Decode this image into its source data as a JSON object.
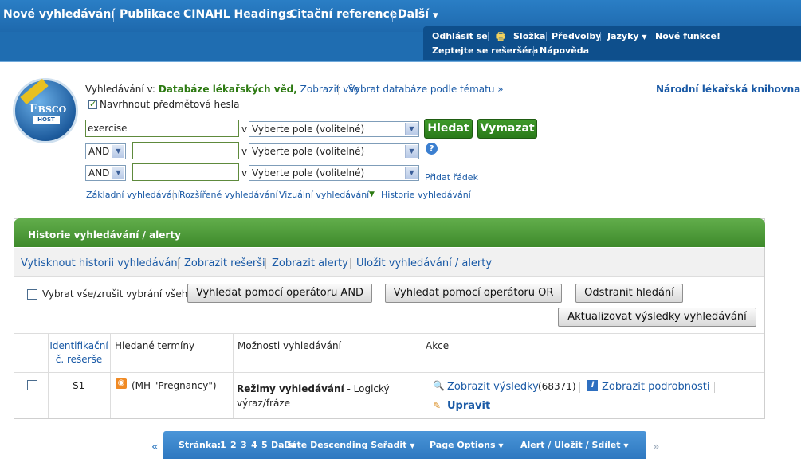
{
  "topnav": {
    "new_search": "Nové vyhledávání",
    "publications": "Publikace",
    "cinahl": "CINAHL Headings",
    "citations": "Citační reference",
    "more": "Další"
  },
  "userbar": {
    "logout": "Odhlásit se",
    "folder": "Složka",
    "preferences": "Předvolby",
    "languages": "Jazyky",
    "new_features": "Nové funkce!",
    "ask_librarian": "Zeptejte se rešeršéra",
    "help": "Nápověda"
  },
  "search": {
    "searching_in_label": "Vyhledávání v:",
    "database": "Databáze lékařských věd,",
    "show_all": "Zobrazit vše",
    "choose_by_topic": "Vybrat databáze podle tématu »",
    "library": "Národní lékařská knihovna",
    "suggest_terms": "Navrhnout předmětová hesla",
    "row1_value": "exercise",
    "in_label": "v",
    "field_placeholder": "Vyberte pole (volitelné)",
    "operator": "AND",
    "search_btn": "Hledat",
    "clear_btn": "Vymazat",
    "add_row": "Přidat řádek",
    "basic": "Základní vyhledávání",
    "advanced": "Rozšířené vyhledávání",
    "visual": "Vizuální vyhledávání",
    "history": "Historie vyhledávání"
  },
  "history": {
    "title": "Historie vyhledávání / alerty",
    "print": "Vytisknout historii vyhledávání",
    "show_searches": "Zobrazit rešerši",
    "show_alerts": "Zobrazit alerty",
    "save": "Uložit vyhledávání / alerty",
    "select_all": "Vybrat vše/zrušit vybrání všeho",
    "and_btn": "Vyhledat pomocí operátoru AND",
    "or_btn": "Vyhledat pomocí operátoru OR",
    "remove_btn": "Odstranit hledání",
    "refresh_btn": "Aktualizovat výsledky vyhledávání",
    "col_id_line1": "Identifikační",
    "col_id_line2": "č. rešerše",
    "col_terms": "Hledané termíny",
    "col_options": "Možnosti vyhledávání",
    "col_actions": "Akce",
    "row": {
      "id": "S1",
      "terms": "(MH \"Pregnancy\")",
      "mode_label": "Režimy vyhledávání",
      "mode_rest_line1": "- Logický",
      "mode_rest_line2": "výraz/fráze",
      "show_results": "Zobrazit výsledky",
      "count": "(68371)",
      "details": "Zobrazit podrobnosti",
      "edit": "Upravit"
    }
  },
  "bottombar": {
    "page_label": "Stránka:",
    "pages": [
      "1",
      "2",
      "3",
      "4",
      "5"
    ],
    "next": "Další",
    "sort": "Date Descending Seřadit",
    "page_options": "Page Options",
    "alert": "Alert / Uložit / Sdílet",
    "prev_arrow": "«",
    "next_arrow": "»"
  },
  "colors": {
    "topnav": "#1e69ad",
    "green": "#2d7a12",
    "link": "#1a5aa6"
  }
}
